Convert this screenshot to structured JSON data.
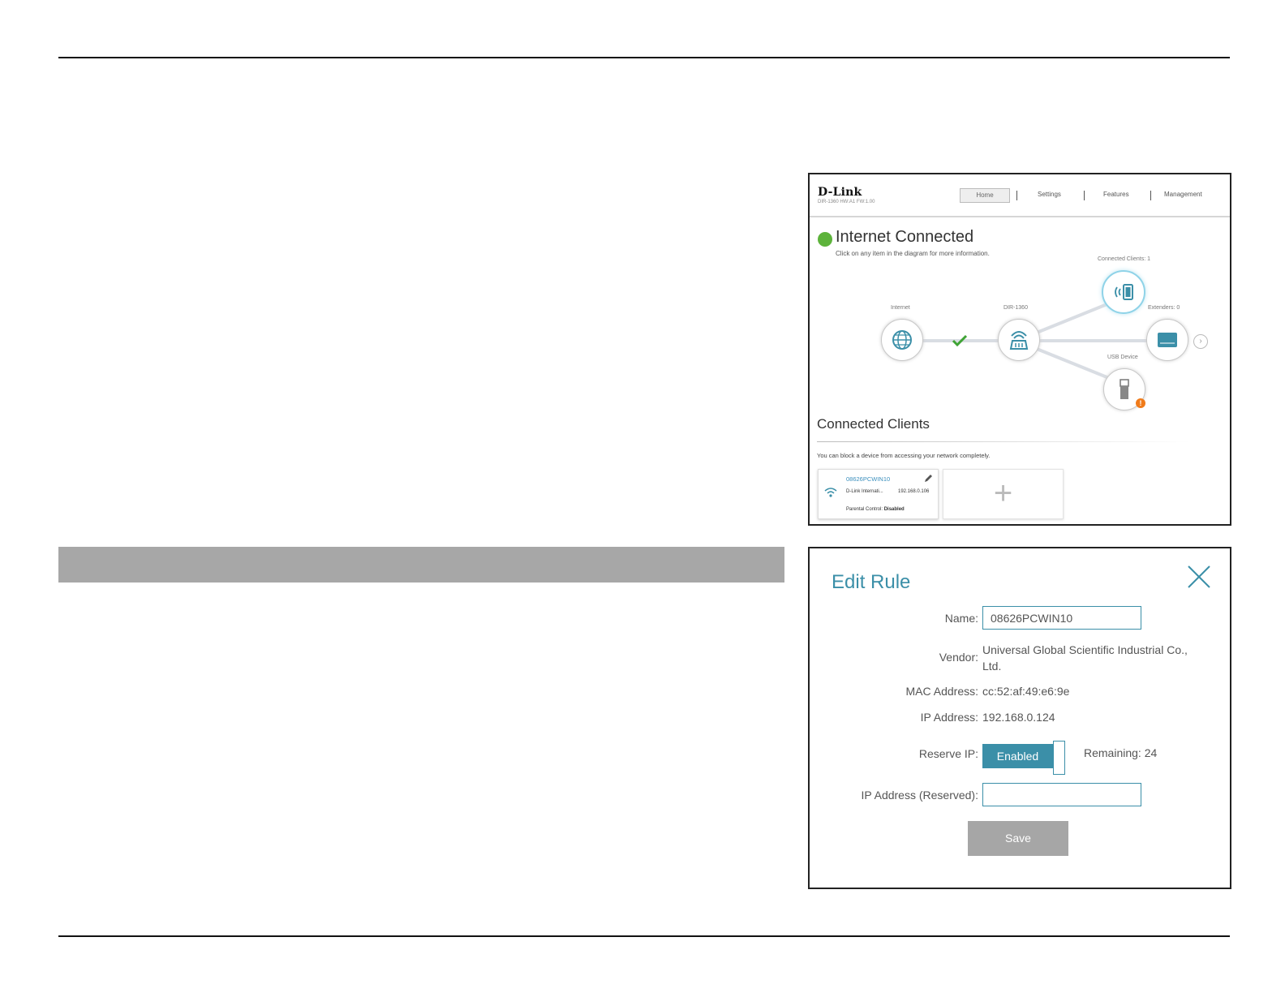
{
  "home": {
    "logo": "D-Link",
    "logo_sub": "DIR-1360 HW:A1 FW:1.00",
    "nav": [
      "Home",
      "Settings",
      "Features",
      "Management"
    ],
    "status_title": "Internet Connected",
    "status_sub": "Click on any item in the diagram for more information.",
    "nodes": {
      "internet": "Internet",
      "router": "DIR-1360",
      "clients": "Connected Clients: 1",
      "extenders": "Extenders: 0",
      "usb": "USB Device"
    },
    "status_color": "#5db33b",
    "warning_color": "#f07b1a",
    "clients_section": {
      "title": "Connected Clients",
      "subtitle": "You can block a device from accessing your network completely.",
      "client": {
        "name": "08626PCWIN10",
        "vendor": "D-Link Internati...",
        "ip": "192.168.0.106",
        "parental_label": "Parental Control:",
        "parental_value": "Disabled"
      },
      "add_symbol": "+"
    }
  },
  "dialog": {
    "title": "Edit Rule",
    "accent_color": "#3b8fa8",
    "name_label": "Name:",
    "name_value": "08626PCWIN10",
    "vendor_label": "Vendor:",
    "vendor_value": "Universal Global Scientific Industrial Co., Ltd.",
    "mac_label": "MAC Address:",
    "mac_value": "cc:52:af:49:e6:9e",
    "ip_label": "IP Address:",
    "ip_value": "192.168.0.124",
    "reserve_label": "Reserve IP:",
    "reserve_state": "Enabled",
    "remaining": "Remaining: 24",
    "reserved_label": "IP Address (Reserved):",
    "reserved_value": "",
    "save_label": "Save"
  }
}
